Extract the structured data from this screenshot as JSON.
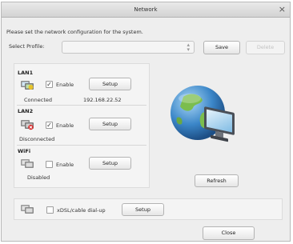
{
  "window": {
    "title": "Network",
    "close_glyph": "×",
    "hint": "Please set the network configuration for the system."
  },
  "profile": {
    "label": "Select Profile:",
    "selected": "",
    "save_label": "Save",
    "delete_label": "Delete"
  },
  "lan1": {
    "title": "LAN1",
    "enable_label": "Enable",
    "enabled": true,
    "setup_label": "Setup",
    "status": "Connected",
    "ip": "192.168.22.52"
  },
  "lan2": {
    "title": "LAN2",
    "enable_label": "Enable",
    "enabled": true,
    "setup_label": "Setup",
    "status": "Disconnected"
  },
  "wifi": {
    "title": "WiFi",
    "enable_label": "Enable",
    "enabled": false,
    "setup_label": "Setup",
    "status": "Disabled"
  },
  "dialup": {
    "label": "xDSL/cable dial-up",
    "enabled": false,
    "setup_label": "Setup"
  },
  "refresh_label": "Refresh",
  "close_label": "Close",
  "check_glyph": "✓",
  "icons": {
    "network_connected": "network-connected-icon",
    "network_disconnected": "network-disconnected-icon",
    "globe_computer": "globe-computer-icon"
  },
  "colors": {
    "globe": "#3b86c8",
    "land": "#7bbd4e",
    "error": "#d62828"
  }
}
